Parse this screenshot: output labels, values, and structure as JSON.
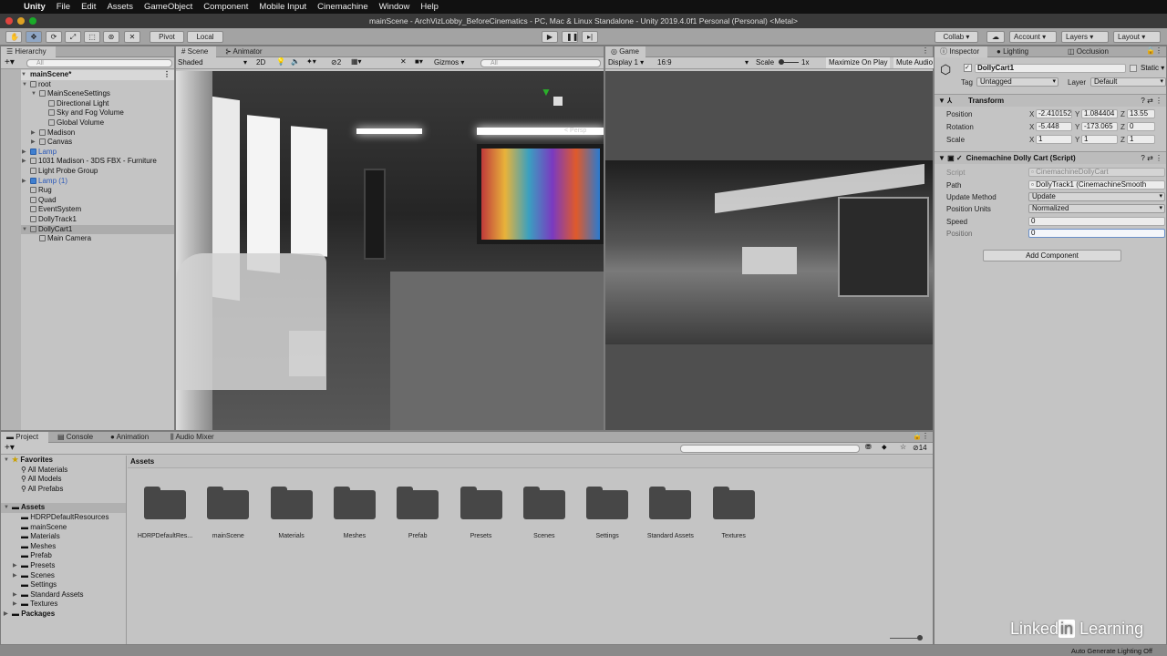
{
  "menubar": {
    "apple": "",
    "app": "Unity",
    "items": [
      "File",
      "Edit",
      "Assets",
      "GameObject",
      "Component",
      "Mobile Input",
      "Cinemachine",
      "Window",
      "Help"
    ]
  },
  "window_title": "mainScene - ArchVizLobby_BeforeCinematics - PC, Mac & Linux Standalone - Unity 2019.4.0f1 Personal (Personal) <Metal>",
  "toolbar": {
    "pivot": "Pivot",
    "local": "Local",
    "collab": "Collab ▾",
    "account": "Account",
    "layers": "Layers",
    "layout": "Layout"
  },
  "hierarchy": {
    "tab": "Hierarchy",
    "search_placeholder": "All",
    "scene": "mainScene*",
    "items": [
      {
        "label": "root",
        "indent": 1,
        "expand": "▼"
      },
      {
        "label": "MainSceneSettings",
        "indent": 2,
        "expand": "▼"
      },
      {
        "label": "Directional Light",
        "indent": 3,
        "expand": ""
      },
      {
        "label": "Sky and Fog Volume",
        "indent": 3,
        "expand": ""
      },
      {
        "label": "Global Volume",
        "indent": 3,
        "expand": ""
      },
      {
        "label": "Madison",
        "indent": 2,
        "expand": "▶"
      },
      {
        "label": "Canvas",
        "indent": 2,
        "expand": "▶"
      },
      {
        "label": "Lamp",
        "indent": 1,
        "expand": "▶",
        "prefab": true
      },
      {
        "label": "1031 Madison - 3DS FBX - Furniture",
        "indent": 1,
        "expand": "▶"
      },
      {
        "label": "Light Probe Group",
        "indent": 1,
        "expand": ""
      },
      {
        "label": "Lamp (1)",
        "indent": 1,
        "expand": "▶",
        "prefab": true
      },
      {
        "label": "Rug",
        "indent": 1,
        "expand": ""
      },
      {
        "label": "Quad",
        "indent": 1,
        "expand": ""
      },
      {
        "label": "EventSystem",
        "indent": 1,
        "expand": ""
      },
      {
        "label": "DollyTrack1",
        "indent": 1,
        "expand": ""
      },
      {
        "label": "DollyCart1",
        "indent": 1,
        "expand": "▼",
        "selected": true
      },
      {
        "label": "Main Camera",
        "indent": 2,
        "expand": ""
      }
    ]
  },
  "scene": {
    "tabs": [
      "Scene",
      "Animator"
    ],
    "shading": "Shaded",
    "mode_2d": "2D",
    "hidden_count": "2",
    "gizmos": "Gizmos",
    "search_placeholder": "All",
    "persp": "< Persp"
  },
  "game": {
    "tab": "Game",
    "display": "Display 1",
    "aspect": "16:9",
    "scale_label": "Scale",
    "scale_value": "1x",
    "maximize": "Maximize On Play",
    "mute": "Mute Audio"
  },
  "inspector": {
    "tabs": [
      "Inspector",
      "Lighting",
      "Occlusion"
    ],
    "object_name": "DollyCart1",
    "static": "Static",
    "tag_label": "Tag",
    "tag": "Untagged",
    "layer_label": "Layer",
    "layer": "Default",
    "transform": {
      "title": "Transform",
      "position": {
        "label": "Position",
        "x": "-2.410152",
        "y": "1.084404",
        "z": "13.55"
      },
      "rotation": {
        "label": "Rotation",
        "x": "-5.448",
        "y": "-173.065",
        "z": "0"
      },
      "scale": {
        "label": "Scale",
        "x": "1",
        "y": "1",
        "z": "1"
      }
    },
    "dolly": {
      "title": "Cinemachine Dolly Cart (Script)",
      "script_label": "Script",
      "script": "CinemachineDollyCart",
      "path_label": "Path",
      "path": "DollyTrack1 (CinemachineSmooth",
      "update_label": "Update Method",
      "update": "Update",
      "units_label": "Position Units",
      "units": "Normalized",
      "speed_label": "Speed",
      "speed": "0",
      "position_label": "Position",
      "position": "0"
    },
    "add_component": "Add Component"
  },
  "project": {
    "tabs": [
      "Project",
      "Console",
      "Animation",
      "Audio Mixer"
    ],
    "hidden_count": "14",
    "favorites": "Favorites",
    "fav_items": [
      "All Materials",
      "All Models",
      "All Prefabs"
    ],
    "assets_root": "Assets",
    "asset_tree": [
      {
        "label": "HDRPDefaultResources",
        "expand": ""
      },
      {
        "label": "mainScene",
        "expand": ""
      },
      {
        "label": "Materials",
        "expand": ""
      },
      {
        "label": "Meshes",
        "expand": ""
      },
      {
        "label": "Prefab",
        "expand": ""
      },
      {
        "label": "Presets",
        "expand": "▶"
      },
      {
        "label": "Scenes",
        "expand": "▶"
      },
      {
        "label": "Settings",
        "expand": ""
      },
      {
        "label": "Standard Assets",
        "expand": "▶"
      },
      {
        "label": "Textures",
        "expand": "▶"
      }
    ],
    "packages": "Packages",
    "breadcrumb": "Assets",
    "folders": [
      "HDRPDefaultRes...",
      "mainScene",
      "Materials",
      "Meshes",
      "Prefab",
      "Presets",
      "Scenes",
      "Settings",
      "Standard Assets",
      "Textures"
    ]
  },
  "statusbar": {
    "right": "Auto Generate Lighting Off"
  },
  "watermark": {
    "brand": "LinkedIn Learning"
  }
}
